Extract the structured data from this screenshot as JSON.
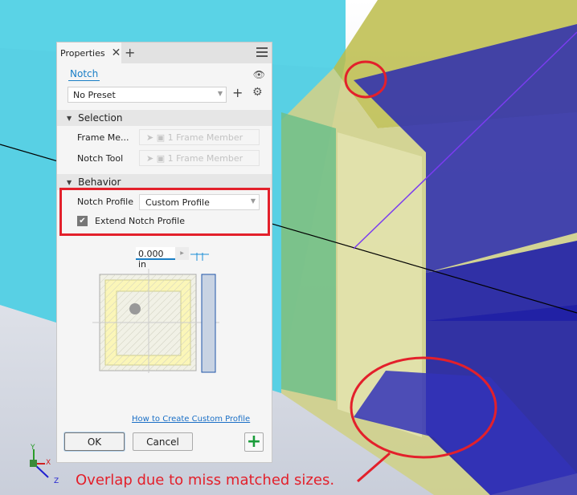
{
  "panel": {
    "tab_label": "Properties",
    "title": "Notch",
    "preset": "No Preset",
    "sections": {
      "selection": "Selection",
      "behavior": "Behavior"
    },
    "selection_rows": [
      {
        "label": "Frame Me...",
        "value": "1 Frame Member"
      },
      {
        "label": "Notch Tool",
        "value": "1 Frame Member"
      }
    ],
    "notch_profile_label": "Notch Profile",
    "notch_profile_value": "Custom Profile",
    "extend_label": "Extend Notch Profile",
    "extend_checked": true,
    "offset_value": "0.000 in",
    "help_link": "How to Create Custom Profile",
    "ok_label": "OK",
    "cancel_label": "Cancel"
  },
  "annotation": "Overlap due to miss matched sizes.",
  "axes": {
    "x": "X",
    "y": "Y",
    "z": "Z"
  },
  "colors": {
    "accent": "#1a7fc6",
    "highlight": "#e3202b",
    "beam": "#5ad3e6",
    "frame": "#c8c86a",
    "notch": "#1a1aa8"
  }
}
